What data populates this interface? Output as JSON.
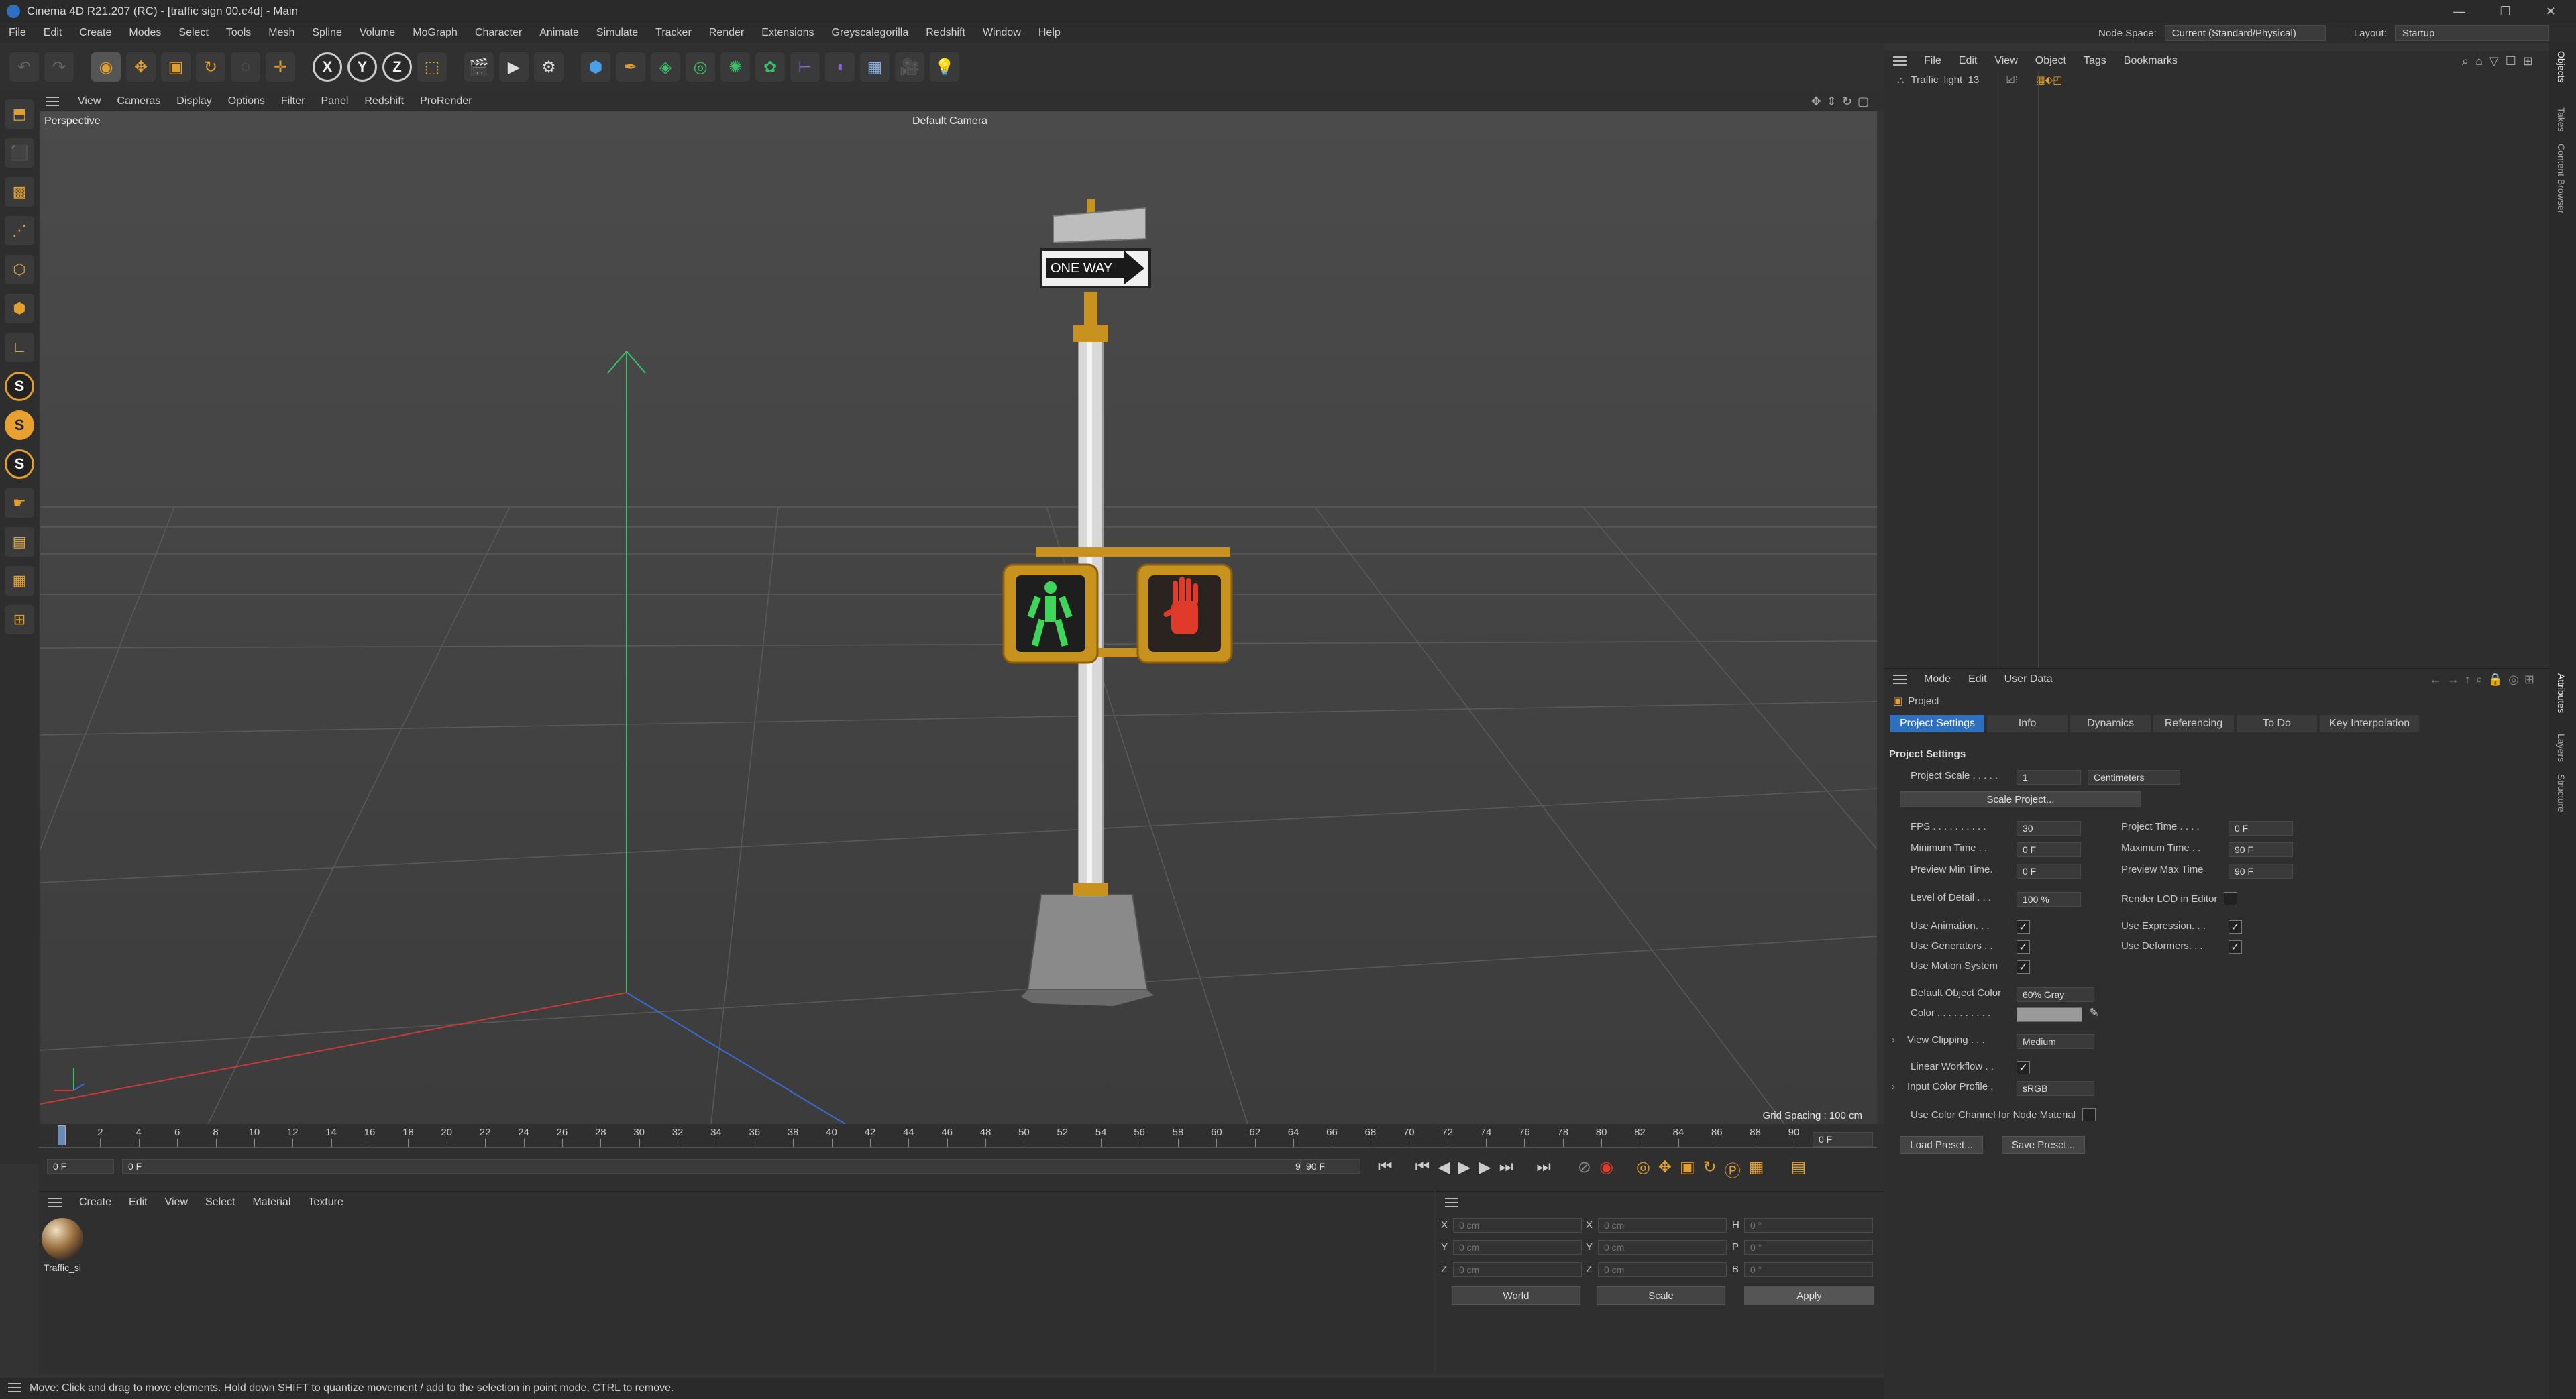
{
  "window": {
    "title": "Cinema 4D R21.207 (RC) - [traffic sign 00.c4d] - Main",
    "controls": [
      "—",
      "❐",
      "✕"
    ]
  },
  "menubar": {
    "items": [
      "File",
      "Edit",
      "Create",
      "Modes",
      "Select",
      "Tools",
      "Mesh",
      "Spline",
      "Volume",
      "MoGraph",
      "Character",
      "Animate",
      "Simulate",
      "Tracker",
      "Render",
      "Extensions",
      "Greyscalegorilla",
      "Redshift",
      "Window",
      "Help"
    ],
    "node_space_label": "Node Space:",
    "node_space_value": "Current (Standard/Physical)",
    "layout_label": "Layout:",
    "layout_value": "Startup"
  },
  "toolbar": {
    "axis": [
      "X",
      "Y",
      "Z"
    ]
  },
  "viewport": {
    "menu": [
      "View",
      "Cameras",
      "Display",
      "Options",
      "Filter",
      "Panel",
      "Redshift",
      "ProRender"
    ],
    "projection": "Perspective",
    "camera": "Default Camera",
    "grid_spacing": "Grid Spacing : 100 cm",
    "sign_text": "ONE WAY"
  },
  "timeline": {
    "ticks": [
      "0",
      "2",
      "4",
      "6",
      "8",
      "10",
      "12",
      "14",
      "16",
      "18",
      "20",
      "22",
      "24",
      "26",
      "28",
      "30",
      "32",
      "34",
      "36",
      "38",
      "40",
      "42",
      "44",
      "46",
      "48",
      "50",
      "52",
      "54",
      "56",
      "58",
      "60",
      "62",
      "64",
      "66",
      "68",
      "70",
      "72",
      "74",
      "76",
      "78",
      "80",
      "82",
      "84",
      "86",
      "88",
      "90"
    ],
    "current_frame": "0 F",
    "start": "0 F",
    "range_start": "0 F",
    "range_end": "90 F",
    "end": "90 F"
  },
  "material_manager": {
    "menu": [
      "Create",
      "Edit",
      "View",
      "Select",
      "Material",
      "Texture"
    ],
    "material_name": "Traffic_si"
  },
  "coordinates": {
    "rows": [
      {
        "a": "X",
        "av": "0 cm",
        "b": "X",
        "bv": "0 cm",
        "c": "H",
        "cv": "0 °"
      },
      {
        "a": "Y",
        "av": "0 cm",
        "b": "Y",
        "bv": "0 cm",
        "c": "P",
        "cv": "0 °"
      },
      {
        "a": "Z",
        "av": "0 cm",
        "b": "Z",
        "bv": "0 cm",
        "c": "B",
        "cv": "0 °"
      }
    ],
    "world": "World",
    "scale": "Scale",
    "apply": "Apply"
  },
  "object_manager": {
    "menu": [
      "File",
      "Edit",
      "View",
      "Object",
      "Tags",
      "Bookmarks"
    ],
    "object_name": "Traffic_light_13"
  },
  "right_tabs": [
    "Objects",
    "Takes",
    "Content Browser",
    "Attributes",
    "Layers",
    "Structure"
  ],
  "attributes": {
    "menu": [
      "Mode",
      "Edit",
      "User Data"
    ],
    "header": "Project",
    "tabs": [
      "Project Settings",
      "Info",
      "Dynamics",
      "Referencing",
      "To Do",
      "Key Interpolation"
    ],
    "section": "Project Settings",
    "project_scale_label": "Project Scale . . . . .",
    "project_scale_value": "1",
    "project_scale_unit": "Centimeters",
    "scale_project_button": "Scale Project...",
    "fps_label": "FPS . . . . . . . . . .",
    "fps_value": "30",
    "project_time_label": "Project Time . . . .",
    "project_time_value": "0 F",
    "min_time_label": "Minimum Time . .",
    "min_time_value": "0 F",
    "max_time_label": "Maximum Time . .",
    "max_time_value": "90 F",
    "preview_min_label": "Preview Min Time.",
    "preview_min_value": "0 F",
    "preview_max_label": "Preview Max Time",
    "preview_max_value": "90 F",
    "lod_label": "Level of Detail . . .",
    "lod_value": "100 %",
    "render_lod_label": "Render LOD in Editor",
    "use_animation_label": "Use Animation. . .",
    "use_expression_label": "Use Expression. . .",
    "use_generators_label": "Use Generators . .",
    "use_deformers_label": "Use Deformers. . .",
    "use_motion_label": "Use Motion System",
    "default_color_label": "Default Object Color",
    "default_color_value": "60% Gray",
    "color_label": "Color . . . . . . . . . .",
    "view_clipping_label": "View Clipping . . .",
    "view_clipping_value": "Medium",
    "linear_workflow_label": "Linear Workflow . .",
    "input_profile_label": "Input Color Profile .",
    "input_profile_value": "sRGB",
    "color_channel_label": "Use Color Channel for Node Material",
    "load_preset": "Load Preset...",
    "save_preset": "Save Preset..."
  },
  "status": "Move: Click and drag to move elements. Hold down SHIFT to quantize movement / add to the selection in point mode, CTRL to remove.",
  "colors": {
    "accent": "#2d6fc0",
    "brass": "#c8921e",
    "walk_green": "#3fd45a",
    "hand_red": "#e03a2a"
  }
}
